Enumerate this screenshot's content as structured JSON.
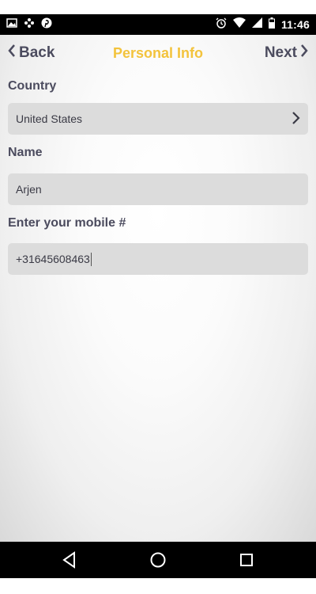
{
  "status_bar": {
    "time": "11:46",
    "left_icons": [
      "image-icon",
      "dots-icon",
      "pinterest-icon"
    ],
    "right_icons": [
      "alarm-icon",
      "wifi-icon",
      "signal-icon",
      "battery-icon"
    ]
  },
  "nav": {
    "back_label": "Back",
    "title": "Personal Info",
    "next_label": "Next"
  },
  "form": {
    "country_label": "Country",
    "country_value": "United States",
    "name_label": "Name",
    "name_value": "Arjen",
    "mobile_label": "Enter your mobile #",
    "mobile_value": "+31645608463"
  },
  "system_nav": {
    "icons": [
      "back-triangle-icon",
      "home-circle-icon",
      "recents-square-icon"
    ]
  },
  "colors": {
    "title": "#f3c33c",
    "text": "#4b4b5e",
    "field_bg": "#dcdcdc"
  }
}
